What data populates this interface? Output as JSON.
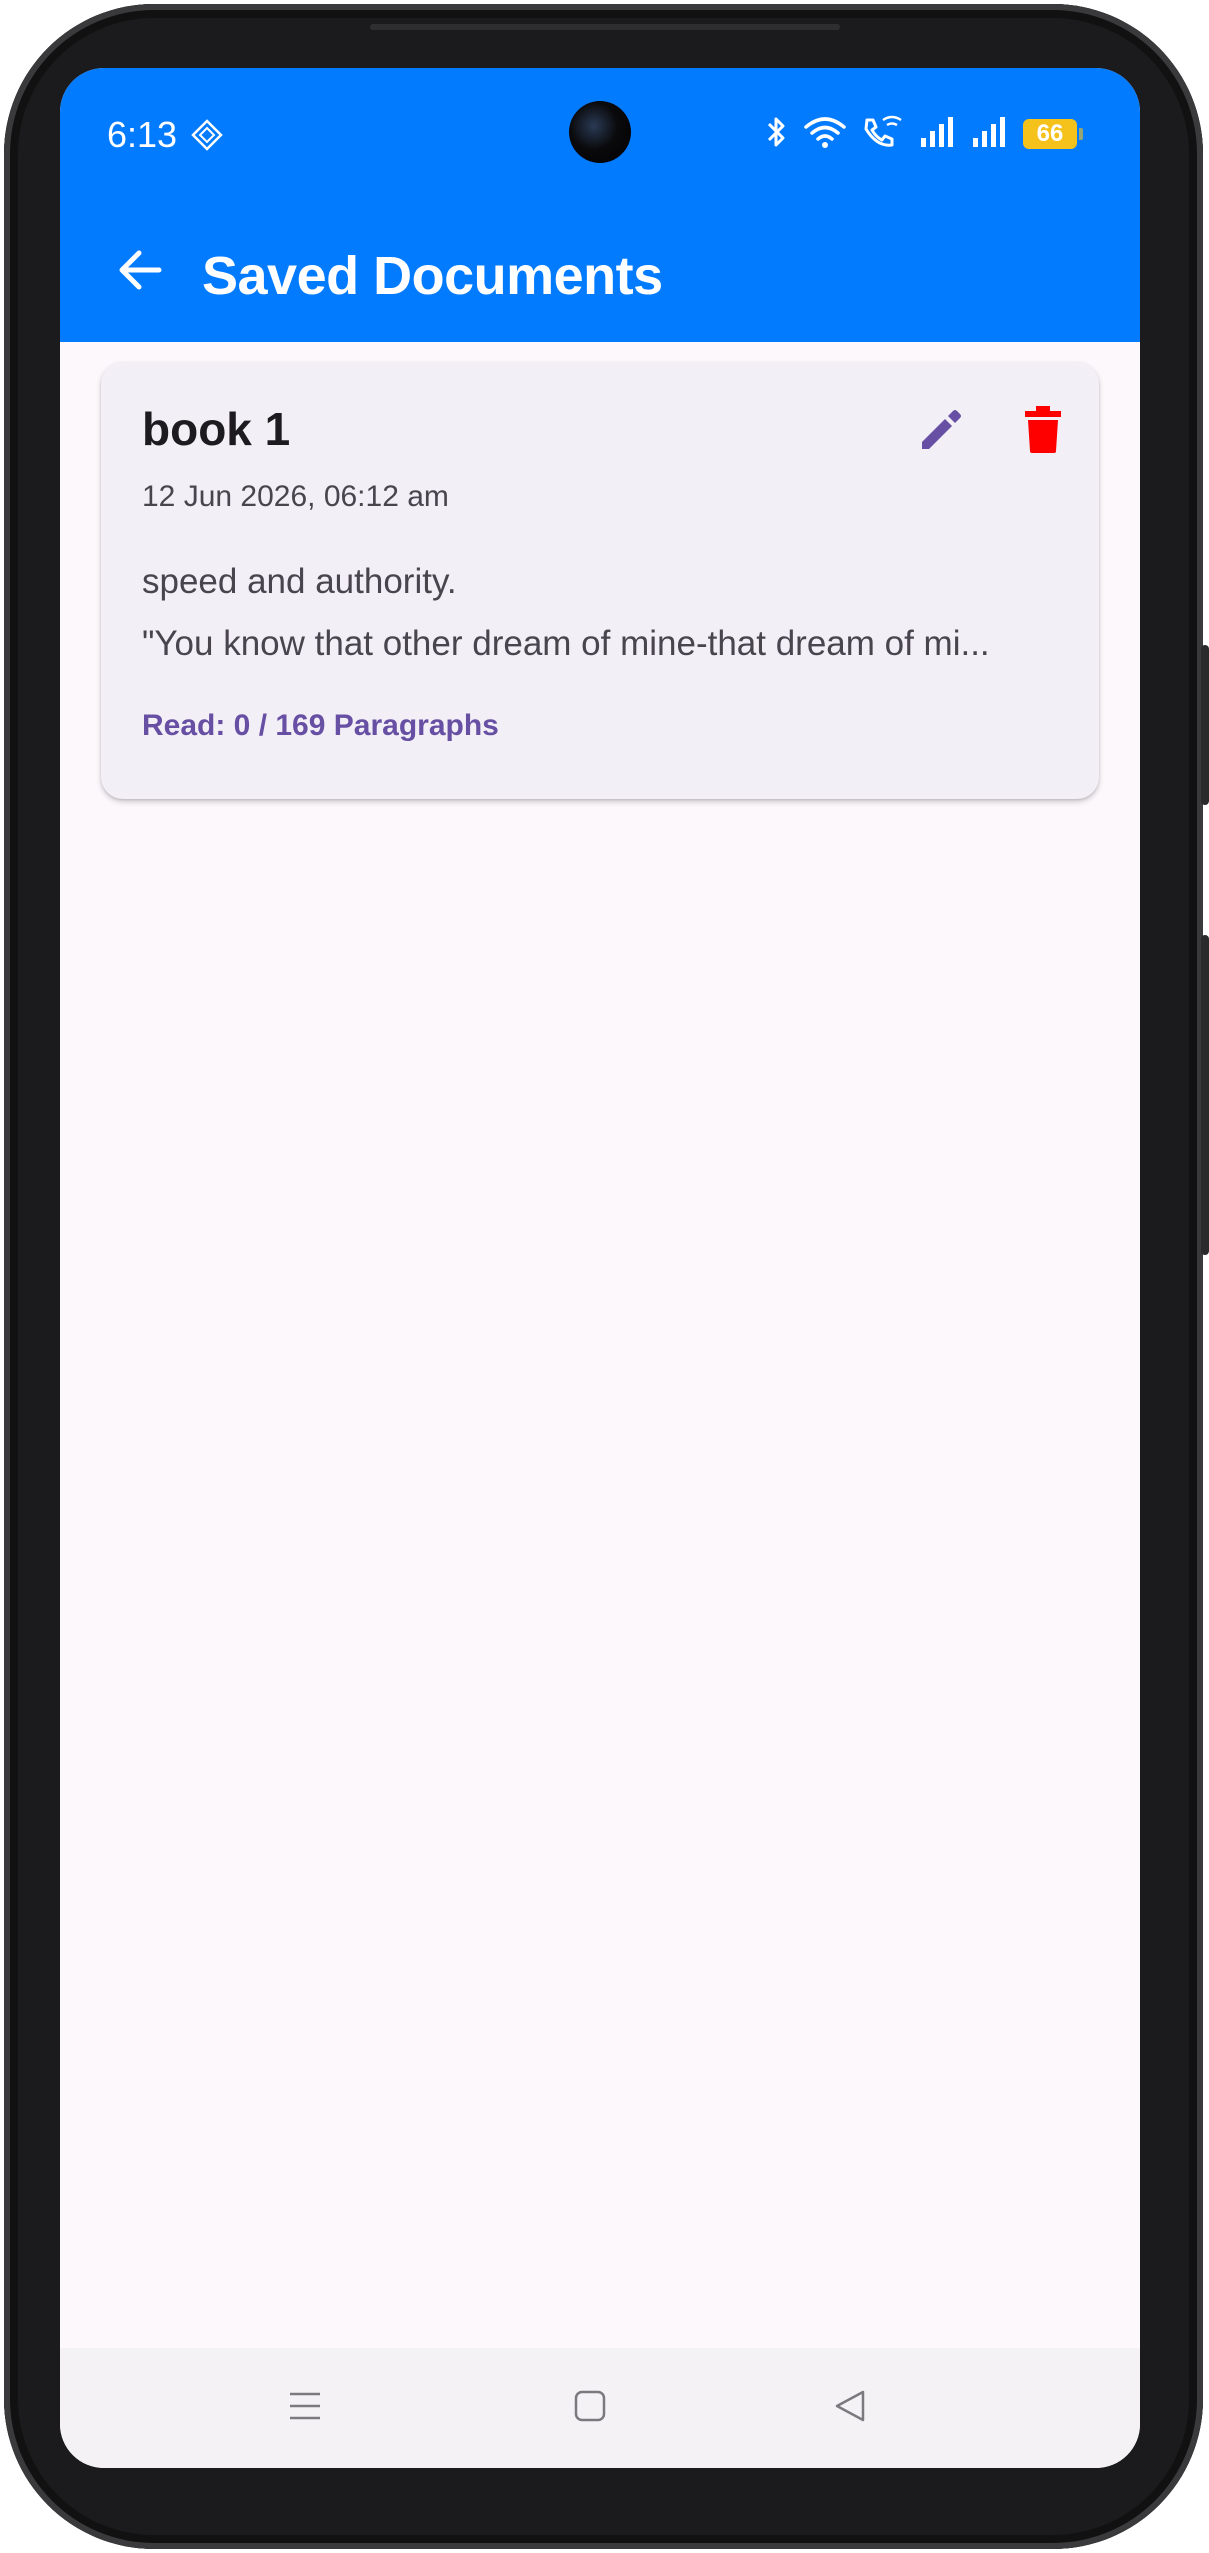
{
  "status_bar": {
    "time": "6:13",
    "battery": "66"
  },
  "app_bar": {
    "title": "Saved Documents",
    "background_color": "#037bff"
  },
  "documents": [
    {
      "title": "book 1",
      "date": "12 Jun 2026, 06:12 am",
      "preview_line_1": "speed and authority.",
      "preview_line_2": "\"You know that other dream of mine-that dream of mi...",
      "progress": "Read: 0 / 169 Paragraphs"
    }
  ],
  "icons": {
    "back": "arrow-back-icon",
    "edit": "pencil-icon",
    "delete": "trash-icon",
    "nav_menu": "menu-lines-icon",
    "nav_home": "square-home-icon",
    "nav_back": "triangle-back-icon"
  },
  "colors": {
    "accent": "#6750a4",
    "delete": "#ff0000",
    "card_bg": "#f3eff6",
    "page_bg": "#fcf8fc"
  }
}
